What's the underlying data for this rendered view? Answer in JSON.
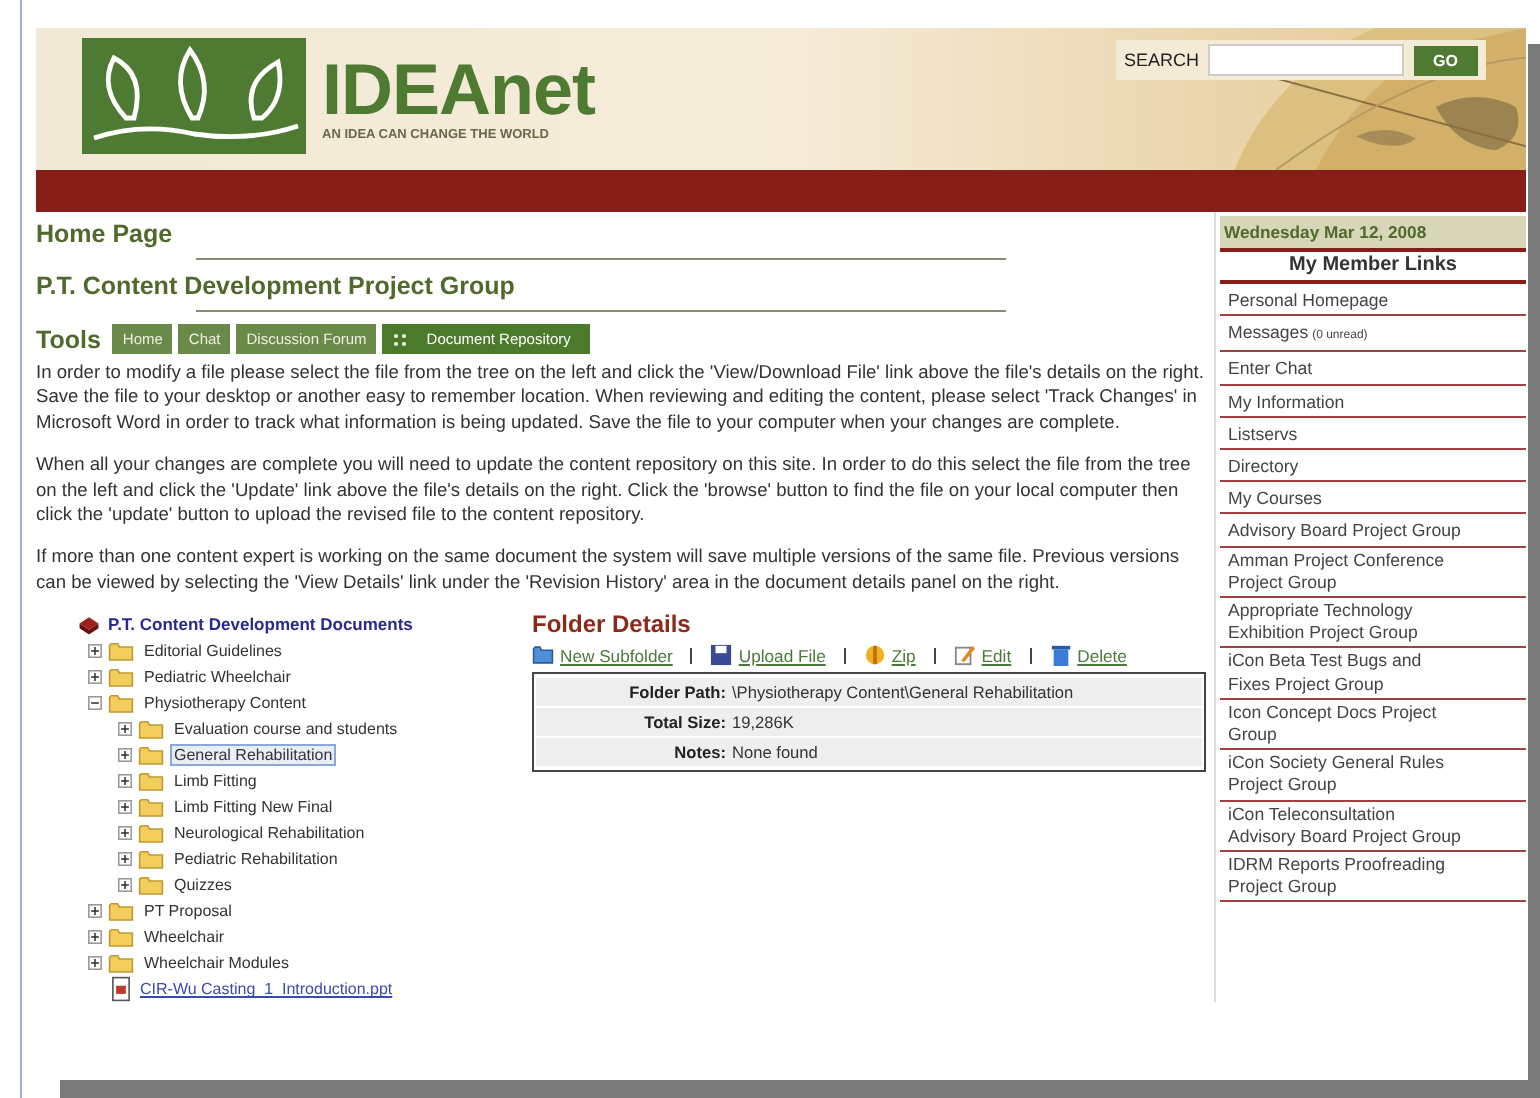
{
  "header": {
    "logo_title": "IDEAnet",
    "tagline": "AN IDEA CAN CHANGE THE WORLD",
    "search": {
      "label": "SEARCH",
      "button": "GO"
    }
  },
  "page_title": "Home Page",
  "group_title": "P.T. Content Development Project Group",
  "tools": {
    "label": "Tools",
    "buttons": [
      {
        "label": "Home",
        "selected": false
      },
      {
        "label": "Chat",
        "selected": false
      },
      {
        "label": "Discussion Forum",
        "selected": false
      },
      {
        "label": "Document Repository",
        "selected": true
      }
    ]
  },
  "paragraphs": [
    "In order to modify a file please select the file from the tree on the left and click the 'View/Download File' link above the file's details on the right. Save the file to your desktop or another easy to remember location. When reviewing and editing the content, please select 'Track Changes' in Microsoft Word in order to track what information is being updated. Save the file to your computer when your changes are complete.",
    "When all your changes are complete you will need to update the content repository on this site. In order to do this select the file from the tree on the left and click the 'Update' link above the file's details on the right. Click the 'browse' button to find the file on your local computer then click the 'update' button to upload the revised file to the content repository.",
    "If more than one content expert is working on the same document the system will save multiple versions of the same file. Previous versions can be viewed by selecting the 'View Details' link under the 'Revision History' area in the document details panel on the right."
  ],
  "tree": {
    "root": "P.T. Content Development Documents",
    "items": [
      {
        "kind": "folder",
        "label": "Editorial Guidelines",
        "expanded": false,
        "selected": false
      },
      {
        "kind": "folder",
        "label": "Pediatric Wheelchair",
        "expanded": false,
        "selected": false
      },
      {
        "kind": "folder",
        "label": "Physiotherapy Content",
        "expanded": true,
        "selected": false,
        "children": [
          {
            "kind": "folder",
            "label": "Evaluation course and students",
            "expanded": false,
            "selected": false
          },
          {
            "kind": "folder",
            "label": "General Rehabilitation",
            "expanded": false,
            "selected": true
          },
          {
            "kind": "folder",
            "label": "Limb Fitting",
            "expanded": false,
            "selected": false
          },
          {
            "kind": "folder",
            "label": "Limb Fitting New Final",
            "expanded": false,
            "selected": false
          },
          {
            "kind": "folder",
            "label": "Neurological Rehabilitation",
            "expanded": false,
            "selected": false
          },
          {
            "kind": "folder",
            "label": "Pediatric Rehabilitation",
            "expanded": false,
            "selected": false
          },
          {
            "kind": "folder",
            "label": "Quizzes",
            "expanded": false,
            "selected": false
          }
        ]
      },
      {
        "kind": "folder",
        "label": "PT Proposal",
        "expanded": false,
        "selected": false
      },
      {
        "kind": "folder",
        "label": "Wheelchair",
        "expanded": false,
        "selected": false
      },
      {
        "kind": "folder",
        "label": "Wheelchair Modules",
        "expanded": false,
        "selected": false
      },
      {
        "kind": "file",
        "label": "CIR-Wu Casting_1_Introduction.ppt",
        "selected": false
      }
    ]
  },
  "folder_details": {
    "title": "Folder Details",
    "actions": [
      {
        "kind": "new-folder",
        "label": "New Subfolder"
      },
      {
        "kind": "upload",
        "label": "Upload File"
      },
      {
        "kind": "zip",
        "label": "Zip"
      },
      {
        "kind": "edit",
        "label": "Edit"
      },
      {
        "kind": "delete",
        "label": "Delete"
      }
    ],
    "fields": [
      {
        "label": "Folder Path:",
        "value": "\\Physiotherapy Content\\General Rehabilitation"
      },
      {
        "label": "Total Size:",
        "value": "19,286K"
      },
      {
        "label": "Notes:",
        "value": "None found"
      }
    ]
  },
  "sidebar": {
    "date": "Wednesday Mar 12, 2008",
    "heading": "My Member Links",
    "links": [
      {
        "label": "Personal Homepage"
      },
      {
        "label": "Messages",
        "note": "(0 unread)"
      },
      {
        "label": "Enter Chat"
      },
      {
        "label": "My Information"
      },
      {
        "label": "Listservs"
      },
      {
        "label": "Directory"
      },
      {
        "label": "My Courses"
      },
      {
        "label": "Advisory Board Project Group"
      },
      {
        "label": "Amman Project Conference Project Group"
      },
      {
        "label": "Appropriate Technology Exhibition Project Group"
      },
      {
        "label": "iCon Beta Test Bugs and Fixes Project Group"
      },
      {
        "label": "Icon Concept Docs Project Group"
      },
      {
        "label": "iCon Society General Rules Project Group"
      },
      {
        "label": "iCon Teleconsultation Advisory Board Project Group"
      },
      {
        "label": "IDRM Reports Proofreading Project Group"
      }
    ]
  }
}
